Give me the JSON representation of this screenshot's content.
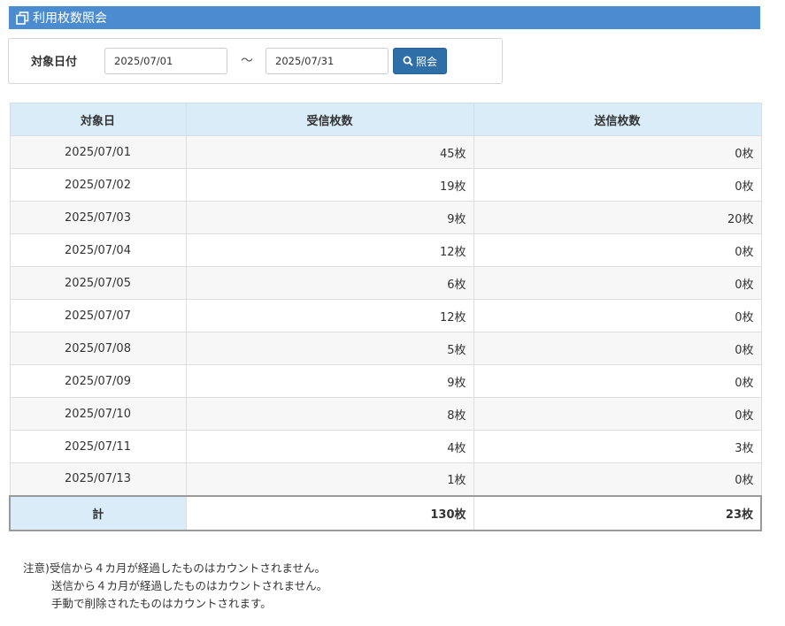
{
  "header": {
    "title": "利用枚数照会",
    "icon": "copy-icon"
  },
  "search": {
    "label": "対象日付",
    "date_from": "2025/07/01",
    "separator": "～",
    "date_to": "2025/07/31",
    "button_label": "照会",
    "button_icon": "search-icon"
  },
  "table": {
    "headers": [
      "対象日",
      "受信枚数",
      "送信枚数"
    ],
    "rows": [
      {
        "date": "2025/07/01",
        "received": "45枚",
        "sent": "0枚"
      },
      {
        "date": "2025/07/02",
        "received": "19枚",
        "sent": "0枚"
      },
      {
        "date": "2025/07/03",
        "received": "9枚",
        "sent": "20枚"
      },
      {
        "date": "2025/07/04",
        "received": "12枚",
        "sent": "0枚"
      },
      {
        "date": "2025/07/05",
        "received": "6枚",
        "sent": "0枚"
      },
      {
        "date": "2025/07/07",
        "received": "12枚",
        "sent": "0枚"
      },
      {
        "date": "2025/07/08",
        "received": "5枚",
        "sent": "0枚"
      },
      {
        "date": "2025/07/09",
        "received": "9枚",
        "sent": "0枚"
      },
      {
        "date": "2025/07/10",
        "received": "8枚",
        "sent": "0枚"
      },
      {
        "date": "2025/07/11",
        "received": "4枚",
        "sent": "3枚"
      },
      {
        "date": "2025/07/13",
        "received": "1枚",
        "sent": "0枚"
      }
    ],
    "total": {
      "label": "計",
      "received": "130枚",
      "sent": "23枚"
    }
  },
  "notes": [
    "注意)受信から４カ月が経過したものはカウントされません。",
    "送信から４カ月が経過したものはカウントされません。",
    "手動で削除されたものはカウントされます。"
  ],
  "colors": {
    "header_bar": "#4a8ccf",
    "table_header": "#d9ecf7",
    "button": "#2f6fa8"
  }
}
